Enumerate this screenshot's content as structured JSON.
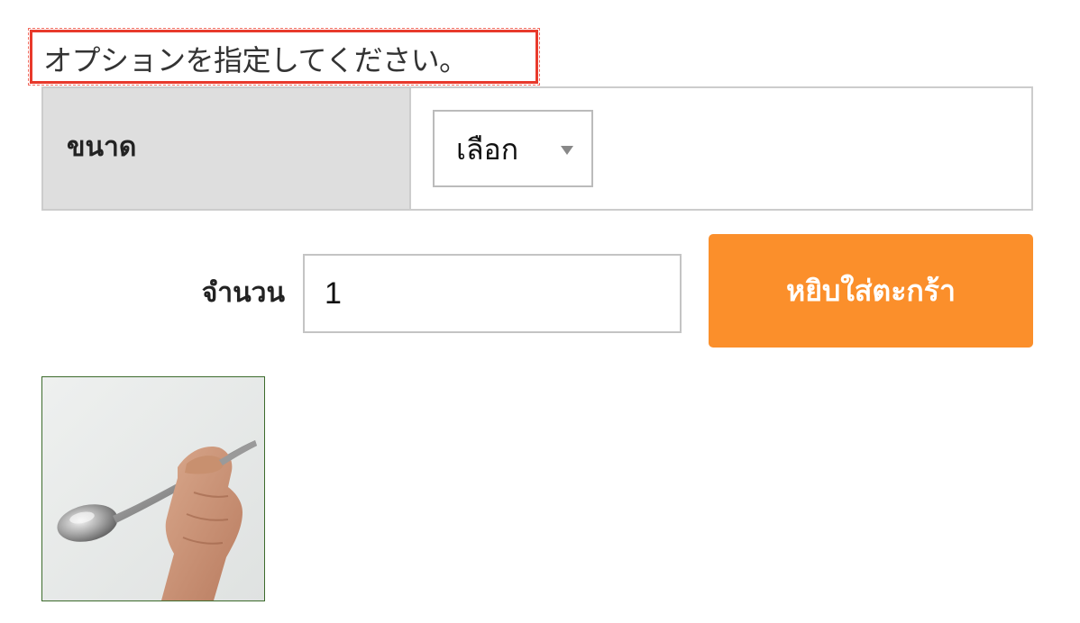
{
  "notice": {
    "text": "オプションを指定してください。"
  },
  "options": {
    "size_label": "ขนาด",
    "size_select_value": "เลือก"
  },
  "quantity": {
    "label": "จำนวน",
    "value": "1"
  },
  "cart": {
    "button_label": "หยิบใส่ตะกร้า"
  },
  "colors": {
    "notice_frame": "#e83a2c",
    "button_bg": "#fb8f2b",
    "label_cell_bg": "#dedede"
  },
  "thumbnail": {
    "icon": "spoon-product-photo-icon"
  }
}
